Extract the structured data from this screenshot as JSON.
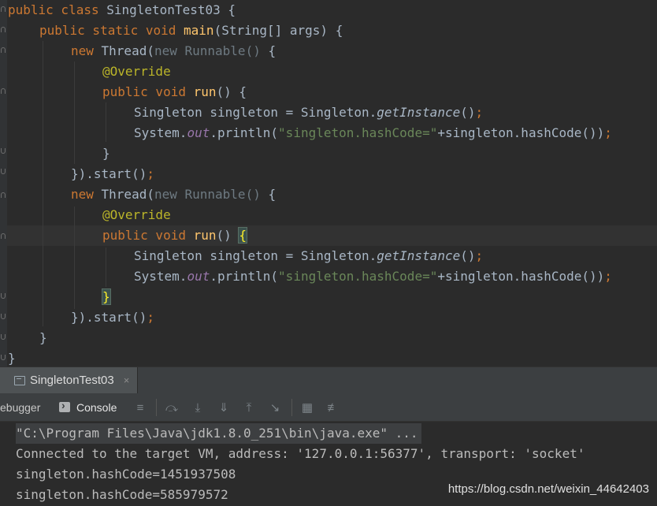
{
  "code": {
    "l1": {
      "kw": "public class ",
      "name": "SingletonTest03 {"
    },
    "l2": {
      "kw": "public static void ",
      "fn": "main",
      "rest": "(String[] args) {"
    },
    "l3": {
      "kw": "new ",
      "cls": "Thread(",
      "dim": "new Runnable() ",
      "rest": "{"
    },
    "l4": {
      "ann": "@Override"
    },
    "l5": {
      "kw": "public void ",
      "fn": "run",
      "rest": "() {"
    },
    "l6": {
      "a": "Singleton singleton = Singleton.",
      "m": "getInstance",
      "b": "()",
      "semi": ";"
    },
    "l7": {
      "a": "System.",
      "f": "out",
      "b": ".println(",
      "s": "\"singleton.hashCode=\"",
      "c": "+singleton.hashCode())",
      "semi": ";"
    },
    "l8": {
      "rest": "}"
    },
    "l9": {
      "a": "}).start()",
      "semi": ";"
    },
    "l10": {
      "kw": "new ",
      "cls": "Thread(",
      "dim": "new Runnable() ",
      "rest": "{"
    },
    "l11": {
      "ann": "@Override"
    },
    "l12": {
      "kw": "public void ",
      "fn": "run",
      "rest": "() ",
      "brace": "{"
    },
    "l13": {
      "a": "Singleton singleton = Singleton.",
      "m": "getInstance",
      "b": "()",
      "semi": ";"
    },
    "l14": {
      "a": "System.",
      "f": "out",
      "b": ".println(",
      "s": "\"singleton.hashCode=\"",
      "c": "+singleton.hashCode())",
      "semi": ";"
    },
    "l15": {
      "brace": "}"
    },
    "l16": {
      "a": "}).start()",
      "semi": ";"
    },
    "l17": {
      "rest": "}"
    },
    "l18": {
      "rest": "}"
    }
  },
  "run_tab": {
    "label": "SingletonTest03",
    "close": "×"
  },
  "toolbar": {
    "debugger_label": "ebugger",
    "console_label": "Console"
  },
  "console": {
    "lines": [
      "\"C:\\Program Files\\Java\\jdk1.8.0_251\\bin\\java.exe\" ...",
      "Connected to the target VM, address: '127.0.0.1:56377', transport: 'socket'",
      "singleton.hashCode=1451937508",
      "singleton.hashCode=585979572"
    ]
  },
  "watermark": "https://blog.csdn.net/weixin_44642403",
  "colors": {
    "keyword": "#cc7832",
    "function": "#ffc66d",
    "string": "#6a8759",
    "annotation": "#bbb529",
    "field": "#9876aa"
  }
}
